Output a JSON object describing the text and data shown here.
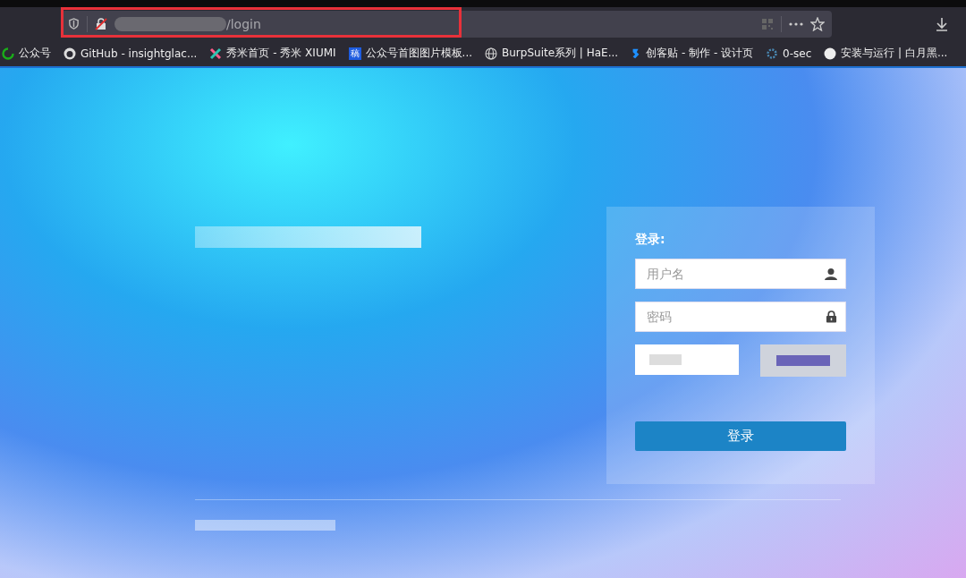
{
  "address_bar": {
    "url": "/login"
  },
  "bookmarks": [
    {
      "kind": "wechat",
      "label": "公众号"
    },
    {
      "kind": "github",
      "label": "GitHub - insightglac..."
    },
    {
      "kind": "xiumi",
      "label": "秀米首页 - 秀米 XIUMI"
    },
    {
      "kind": "gao",
      "label": "公众号首图图片模板...",
      "icon_text": "稿"
    },
    {
      "kind": "globe",
      "label": "BurpSuite系列 | HaE..."
    },
    {
      "kind": "chuangke",
      "label": "创客贴 - 制作 - 设计页"
    },
    {
      "kind": "gear",
      "label": "0-sec"
    },
    {
      "kind": "avatar",
      "label": "安装与运行 | 白月黑..."
    }
  ],
  "login": {
    "title": "登录:",
    "username": {
      "placeholder": "用户名"
    },
    "password": {
      "placeholder": "密码"
    },
    "submit": "登录"
  }
}
